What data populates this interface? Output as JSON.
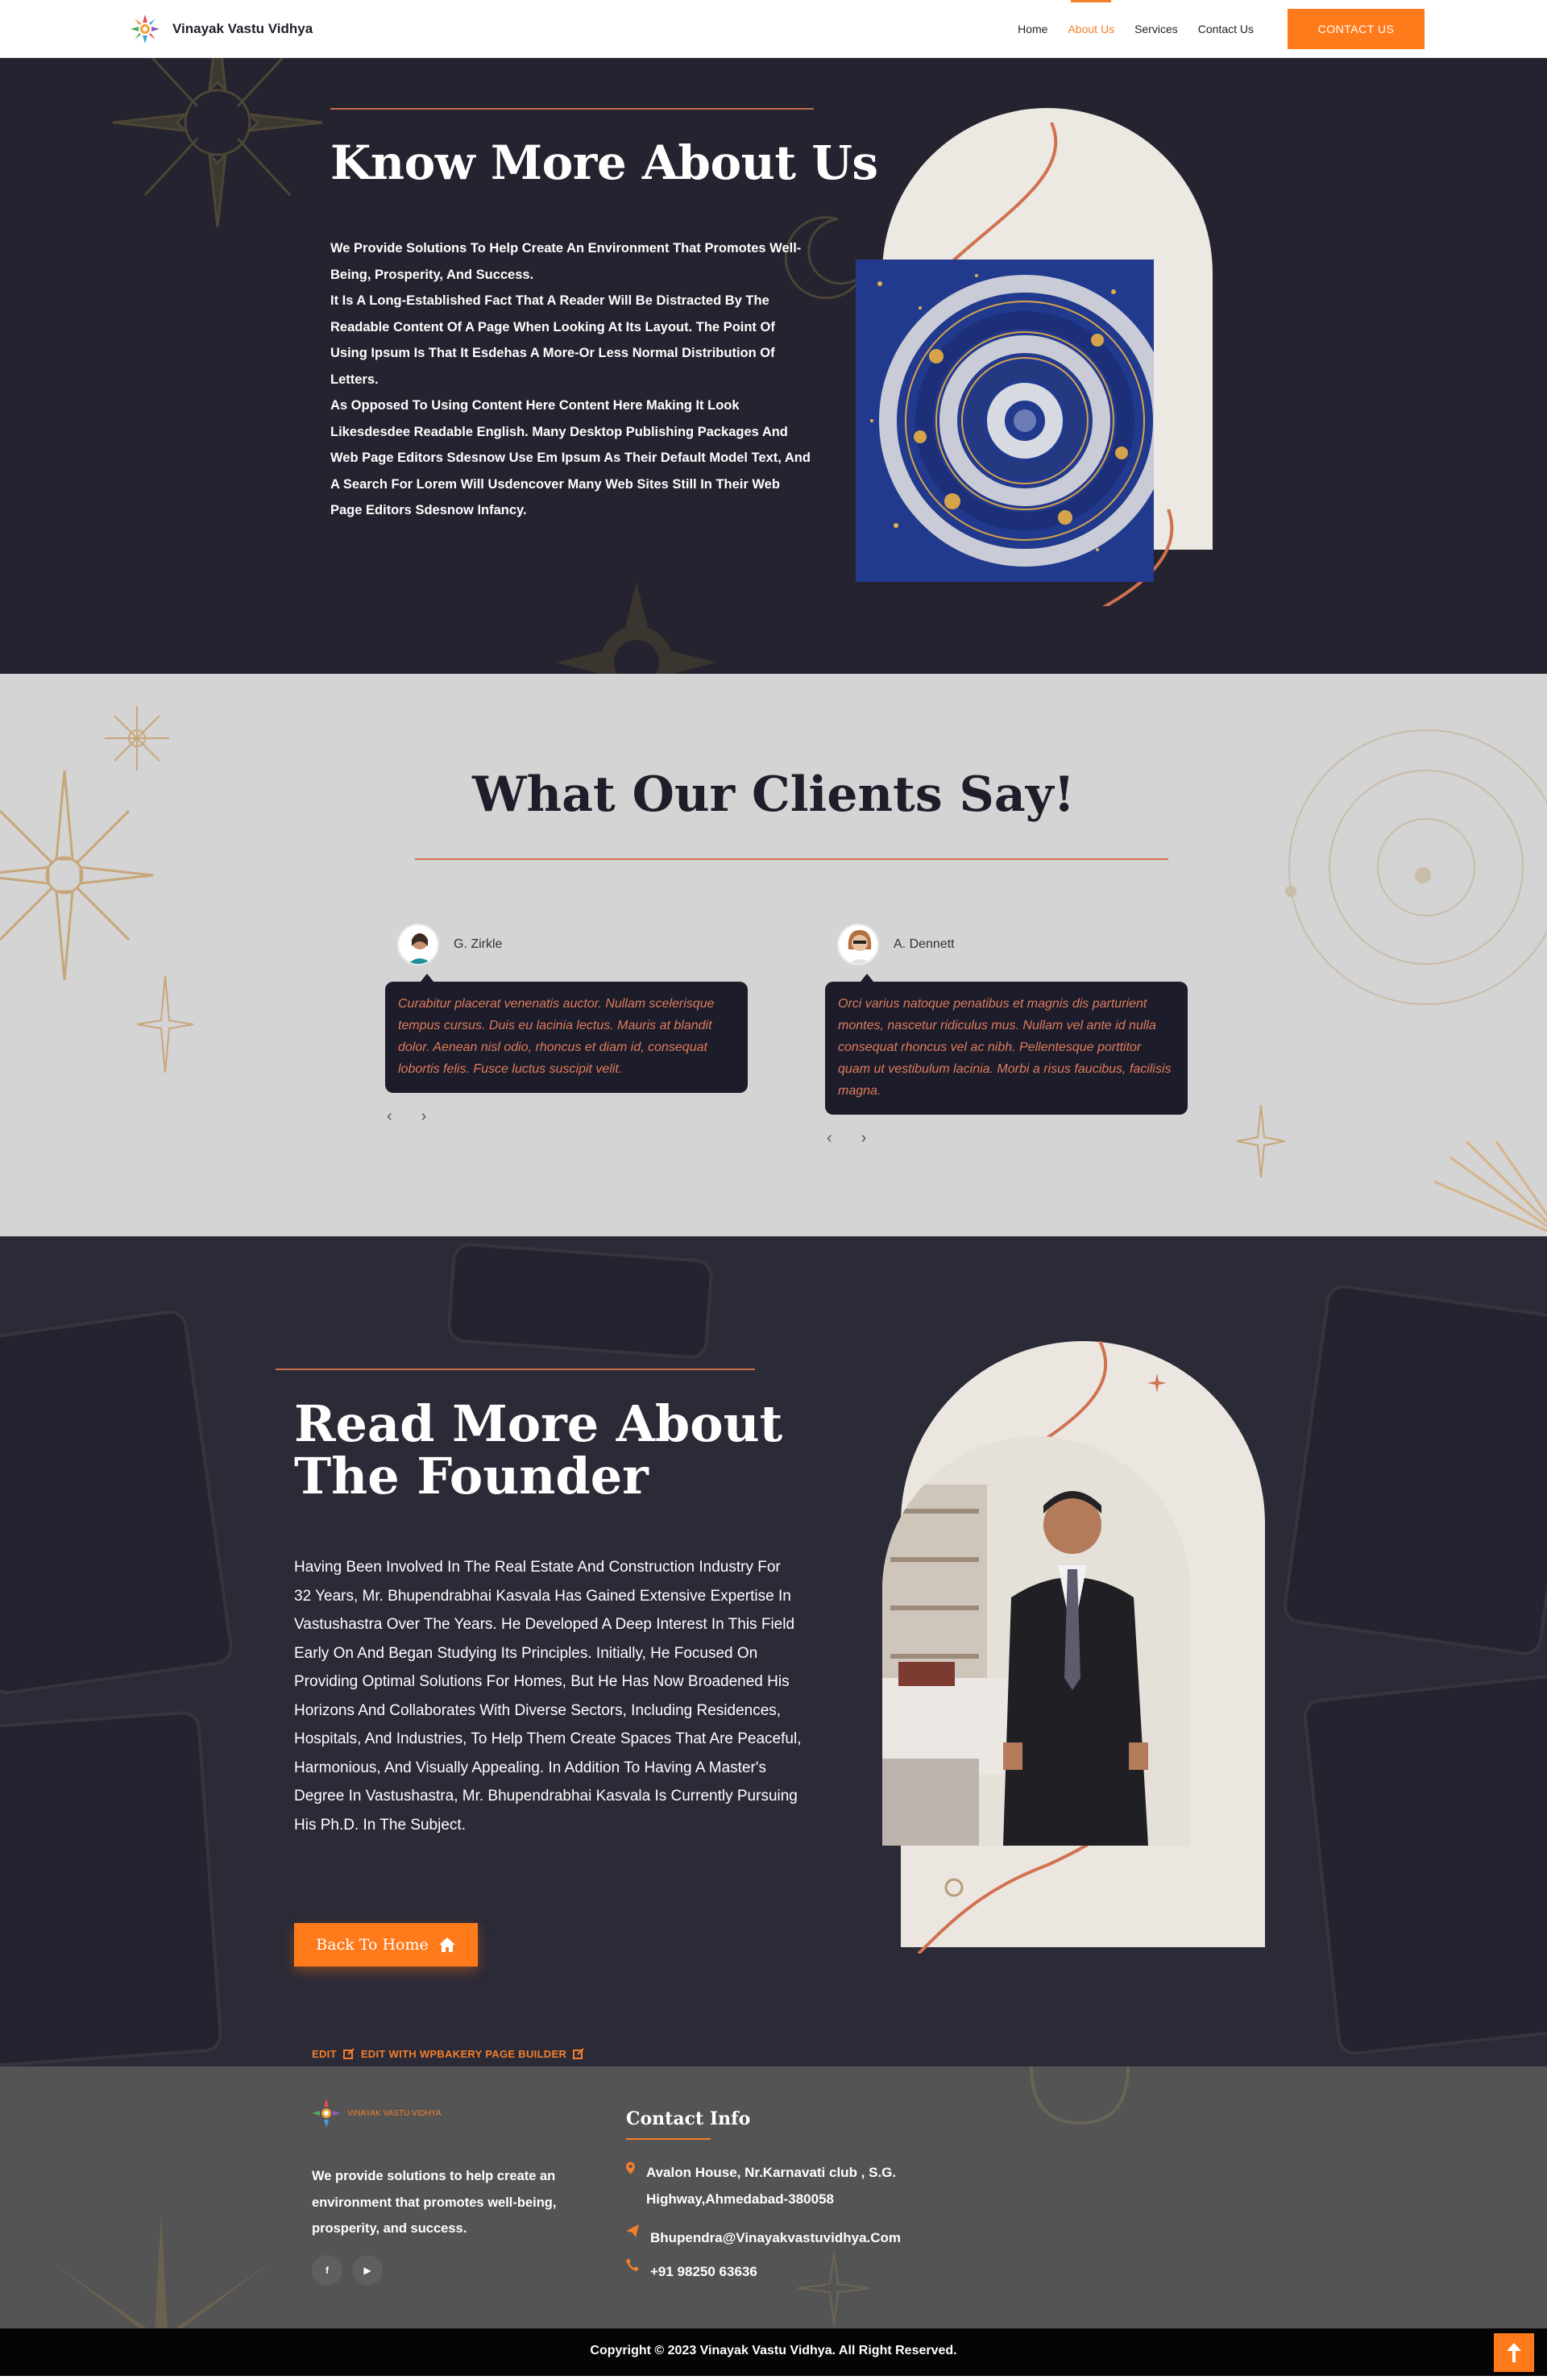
{
  "header": {
    "site_name": "Vinayak Vastu Vidhya",
    "nav": [
      "Home",
      "About Us",
      "Services",
      "Contact Us"
    ],
    "active_nav": "About Us",
    "cta_label": "CONTACT US"
  },
  "about": {
    "title": "Know More About Us",
    "paragraphs": [
      "We Provide Solutions To Help Create An Environment That Promotes Well-Being, Prosperity, And Success.",
      "It Is A Long-Established Fact That A Reader Will Be Distracted By The Readable Content Of A Page When Looking At Its Layout. The Point Of Using Ipsum Is That It Esdehas A More-Or Less Normal Distribution Of Letters.",
      "As Opposed To Using Content Here Content Here Making It Look Likesdesdee Readable English. Many Desktop Publishing Packages And Web Page Editors Sdesnow Use Em Ipsum As Their Default Model Text, And A Search For Lorem Will Usdencover Many Web Sites Still In Their Web Page Editors Sdesnow Infancy."
    ]
  },
  "testimonials": {
    "title": "What Our Clients Say!",
    "items": [
      {
        "name": "G. Zirkle",
        "quote": "Curabitur placerat venenatis auctor. Nullam scelerisque tempus cursus. Duis eu lacinia lectus. Mauris at blandit dolor. Aenean nisl odio, rhoncus et diam id, consequat lobortis felis. Fusce luctus suscipit velit."
      },
      {
        "name": "A. Dennett",
        "quote": "Orci varius natoque penatibus et magnis dis parturient montes, nascetur ridiculus mus. Nullam vel ante id nulla consequat rhoncus vel ac nibh. Pellentesque porttitor quam ut vestibulum lacinia. Morbi a risus faucibus, facilisis magna."
      }
    ],
    "prev_symbol": "‹",
    "next_symbol": "›"
  },
  "founder": {
    "title": "Read More About The Founder",
    "text": "Having Been Involved In The Real Estate And Construction Industry For 32 Years, Mr. Bhupendrabhai Kasvala Has Gained Extensive Expertise In Vastushastra Over The Years. He Developed A Deep Interest In This Field Early On And Began Studying Its Principles. Initially, He Focused On Providing Optimal Solutions For Homes, But He Has Now Broadened His Horizons And Collaborates With Diverse Sectors, Including Residences, Hospitals, And Industries, To Help Them Create Spaces That Are Peaceful, Harmonious, And Visually Appealing. In Addition To Having A Master's Degree In Vastushastra, Mr. Bhupendrabhai Kasvala Is Currently Pursuing His Ph.D. In The Subject.",
    "button_label": "Back To Home",
    "edit_label": "EDIT",
    "edit_builder_label": "EDIT WITH WPBAKERY PAGE BUILDER"
  },
  "footer": {
    "brand": "VINAYAK VASTU VIDHYA",
    "about": "We provide solutions to help create an environment that promotes well-being, prosperity, and success.",
    "social": [
      "f",
      "▶"
    ],
    "contact_title": "Contact Info",
    "address": "Avalon House, Nr.Karnavati club , S.G. Highway,Ahmedabad-380058",
    "email": "Bhupendra@Vinayakvastuvidhya.Com",
    "phone": "+91 98250 63636",
    "copyright": "Copyright © 2023 Vinayak Vastu Vidhya. All Right Reserved."
  },
  "colors": {
    "accent": "#ff7a1a",
    "dark": "#24232f",
    "light_section": "#d4d4d4",
    "footer": "#545454"
  }
}
